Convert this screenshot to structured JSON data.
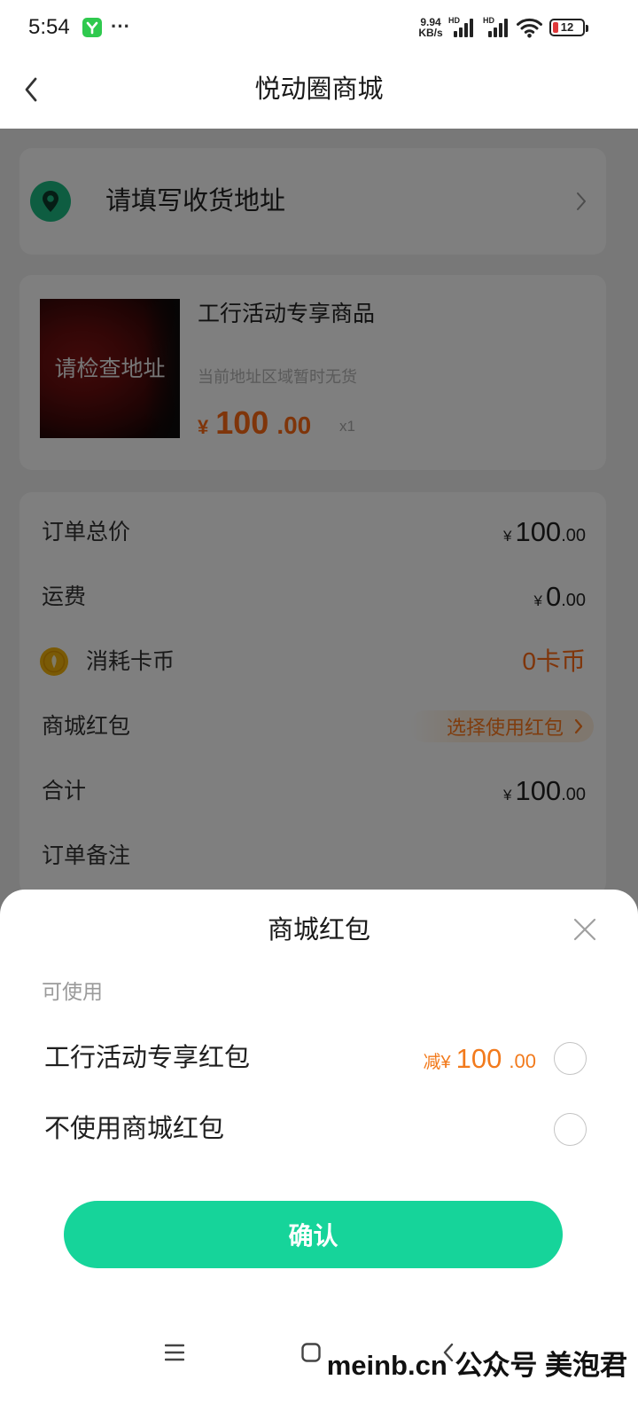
{
  "status_bar": {
    "time": "5:54",
    "more": "···",
    "net_speed_value": "9.94",
    "net_speed_unit": "KB/s",
    "sim1_label": "HD",
    "sim2_label": "HD",
    "battery": "12",
    "icons": [
      "app-notification-icon",
      "cellular-signal-icon",
      "cellular-signal-icon",
      "wifi-icon",
      "battery-icon"
    ]
  },
  "header": {
    "title": "悦动圈商城",
    "back_icon": "chevron-left-icon"
  },
  "address": {
    "placeholder": "请填写收货地址",
    "icon": "location-pin-icon",
    "chevron_icon": "chevron-right-icon"
  },
  "product": {
    "image_notice": "请检查地址",
    "title": "工行活动专享商品",
    "stock_note": "当前地址区域暂时无货",
    "price": {
      "currency": "¥",
      "integer": "100",
      "decimal": ".00"
    },
    "quantity": "x1"
  },
  "order_summary": {
    "total": {
      "label": "订单总价",
      "currency": "¥",
      "integer": "100",
      "decimal": ".00"
    },
    "shipping": {
      "label": "运费",
      "currency": "¥",
      "integer": "0",
      "decimal": ".00"
    },
    "coins": {
      "label": "消耗卡币",
      "value": "0卡币",
      "icon": "coin-icon"
    },
    "red_packet": {
      "label": "商城红包",
      "action": "选择使用红包",
      "icon": "chevron-right-icon"
    },
    "subtotal": {
      "label": "合计",
      "currency": "¥",
      "integer": "100",
      "decimal": ".00"
    },
    "remark": {
      "label": "订单备注"
    }
  },
  "sheet": {
    "title": "商城红包",
    "close_icon": "close-icon",
    "section_label": "可使用",
    "options": [
      {
        "label": "工行活动专享红包",
        "discount_prefix": "减¥",
        "amount_integer": "100",
        "amount_decimal": ".00",
        "selected": false
      },
      {
        "label": "不使用商城红包",
        "selected": false
      }
    ],
    "confirm_label": "确认"
  },
  "system_nav": {
    "icons": [
      "menu-icon",
      "home-icon",
      "back-icon"
    ]
  },
  "watermark": "meinb.cn 公众号 美泡君",
  "colors": {
    "accent": "#16d49a",
    "price": "#ff6a14",
    "discount": "#f27a1c",
    "location": "#1dbb82",
    "coin": "#f5b50c",
    "mask": "rgba(0,0,0,0.5)"
  }
}
